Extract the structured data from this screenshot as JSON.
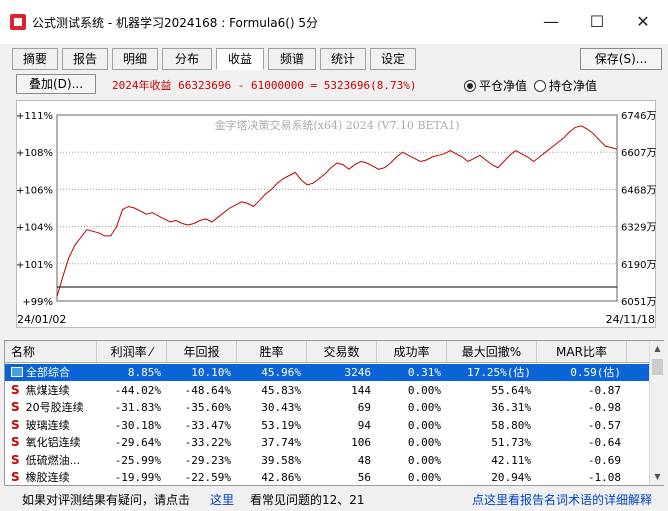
{
  "window": {
    "title": "公式测试系统 - 机器学习2024168 : Formula6() 5分",
    "minimize": "—",
    "maximize": "☐",
    "close": "✕"
  },
  "tabs": [
    "摘要",
    "报告",
    "明细",
    "分布",
    "收益",
    "频谱",
    "统计",
    "设定"
  ],
  "active_tab": "收益",
  "save_button": "保存(S)...",
  "overlay_button": "叠加(D)...",
  "yield_summary": "2024年收益  66323696 - 61000000 = 5323696(8.73%)",
  "radios": {
    "flat": "平仓净值",
    "hold": "持仓净值"
  },
  "chart_data": {
    "type": "line",
    "watermark": "金字塔决策交易系统(x64) 2024 (V7.10 BETA1)",
    "left_ticks": [
      "+111%",
      "+108%",
      "+106%",
      "+104%",
      "+101%",
      "+99%"
    ],
    "right_ticks": [
      "6746万",
      "6607万",
      "6468万",
      "6329万",
      "6190万",
      "6051万"
    ],
    "x_start": "24/01/02",
    "x_end": "24/11/18",
    "ylim": [
      99,
      111
    ],
    "series": [
      {
        "color": "#c00000",
        "values": [
          99.3,
          100.6,
          101.8,
          102.6,
          103.1,
          103.6,
          103.5,
          103.4,
          103.2,
          103.2,
          103.8,
          104.9,
          105.1,
          105.0,
          104.8,
          104.6,
          104.7,
          104.5,
          104.3,
          104.1,
          104.2,
          104.0,
          103.9,
          104.0,
          104.2,
          104.3,
          104.1,
          104.4,
          104.7,
          105.0,
          105.2,
          105.4,
          105.3,
          105.1,
          105.5,
          105.9,
          106.2,
          106.6,
          106.9,
          107.1,
          107.3,
          106.8,
          106.5,
          106.6,
          106.9,
          107.2,
          107.6,
          107.9,
          107.8,
          107.5,
          107.8,
          108.0,
          107.9,
          107.7,
          107.5,
          107.6,
          107.9,
          108.3,
          108.6,
          108.4,
          108.2,
          108.0,
          108.1,
          108.3,
          108.4,
          108.5,
          108.7,
          108.5,
          108.3,
          108.0,
          108.2,
          108.4,
          108.1,
          107.8,
          107.6,
          108.0,
          108.4,
          108.7,
          108.5,
          108.3,
          108.0,
          108.3,
          108.6,
          108.9,
          109.2,
          109.5,
          109.9,
          110.2,
          110.3,
          110.1,
          109.8,
          109.4,
          109.0,
          108.9,
          108.8
        ]
      }
    ]
  },
  "table": {
    "headers": [
      "名称",
      "利润率 ⁄",
      "年回报",
      "胜率",
      "交易数",
      "成功率",
      "最大回撤%",
      "MAR比率"
    ],
    "rows": [
      {
        "name": "全部综合",
        "icon": "folder-icon",
        "profit": "8.85%",
        "annual": "10.10%",
        "win": "45.96%",
        "trades": "3246",
        "success": "0.31%",
        "drawdown": "17.25%(估)",
        "mar": "0.59(估)",
        "selected": true
      },
      {
        "name": "焦煤连续",
        "icon": "S",
        "profit": "-44.02%",
        "annual": "-48.64%",
        "win": "45.83%",
        "trades": "144",
        "success": "0.00%",
        "drawdown": "55.64%",
        "mar": "-0.87"
      },
      {
        "name": "20号胶连续",
        "icon": "S",
        "profit": "-31.83%",
        "annual": "-35.60%",
        "win": "30.43%",
        "trades": "69",
        "success": "0.00%",
        "drawdown": "36.31%",
        "mar": "-0.98"
      },
      {
        "name": "玻璃连续",
        "icon": "S",
        "profit": "-30.18%",
        "annual": "-33.47%",
        "win": "53.19%",
        "trades": "94",
        "success": "0.00%",
        "drawdown": "58.80%",
        "mar": "-0.57"
      },
      {
        "name": "氧化铝连续",
        "icon": "S",
        "profit": "-29.64%",
        "annual": "-33.22%",
        "win": "37.74%",
        "trades": "106",
        "success": "0.00%",
        "drawdown": "51.73%",
        "mar": "-0.64"
      },
      {
        "name": "低硫燃油...",
        "icon": "S",
        "profit": "-25.99%",
        "annual": "-29.23%",
        "win": "39.58%",
        "trades": "48",
        "success": "0.00%",
        "drawdown": "42.11%",
        "mar": "-0.69"
      },
      {
        "name": "橡胶连续",
        "icon": "S",
        "profit": "-19.99%",
        "annual": "-22.59%",
        "win": "42.86%",
        "trades": "56",
        "success": "0.00%",
        "drawdown": "20.94%",
        "mar": "-1.08"
      }
    ]
  },
  "status": {
    "prefix": "如果对评测结果有疑问，请点击",
    "link1": "这里",
    "faq": "看常见问题的12、21",
    "link2": "点这里看报告名词术语的详细解释"
  }
}
